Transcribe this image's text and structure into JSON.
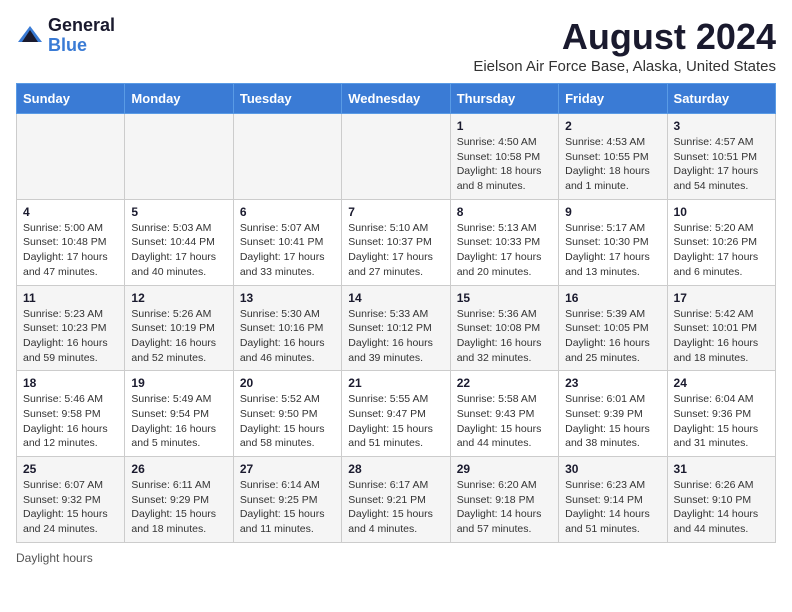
{
  "logo": {
    "general": "General",
    "blue": "Blue"
  },
  "title": "August 2024",
  "location": "Eielson Air Force Base, Alaska, United States",
  "days_of_week": [
    "Sunday",
    "Monday",
    "Tuesday",
    "Wednesday",
    "Thursday",
    "Friday",
    "Saturday"
  ],
  "weeks": [
    [
      {
        "day": "",
        "info": ""
      },
      {
        "day": "",
        "info": ""
      },
      {
        "day": "",
        "info": ""
      },
      {
        "day": "",
        "info": ""
      },
      {
        "day": "1",
        "info": "Sunrise: 4:50 AM\nSunset: 10:58 PM\nDaylight: 18 hours\nand 8 minutes."
      },
      {
        "day": "2",
        "info": "Sunrise: 4:53 AM\nSunset: 10:55 PM\nDaylight: 18 hours\nand 1 minute."
      },
      {
        "day": "3",
        "info": "Sunrise: 4:57 AM\nSunset: 10:51 PM\nDaylight: 17 hours\nand 54 minutes."
      }
    ],
    [
      {
        "day": "4",
        "info": "Sunrise: 5:00 AM\nSunset: 10:48 PM\nDaylight: 17 hours\nand 47 minutes."
      },
      {
        "day": "5",
        "info": "Sunrise: 5:03 AM\nSunset: 10:44 PM\nDaylight: 17 hours\nand 40 minutes."
      },
      {
        "day": "6",
        "info": "Sunrise: 5:07 AM\nSunset: 10:41 PM\nDaylight: 17 hours\nand 33 minutes."
      },
      {
        "day": "7",
        "info": "Sunrise: 5:10 AM\nSunset: 10:37 PM\nDaylight: 17 hours\nand 27 minutes."
      },
      {
        "day": "8",
        "info": "Sunrise: 5:13 AM\nSunset: 10:33 PM\nDaylight: 17 hours\nand 20 minutes."
      },
      {
        "day": "9",
        "info": "Sunrise: 5:17 AM\nSunset: 10:30 PM\nDaylight: 17 hours\nand 13 minutes."
      },
      {
        "day": "10",
        "info": "Sunrise: 5:20 AM\nSunset: 10:26 PM\nDaylight: 17 hours\nand 6 minutes."
      }
    ],
    [
      {
        "day": "11",
        "info": "Sunrise: 5:23 AM\nSunset: 10:23 PM\nDaylight: 16 hours\nand 59 minutes."
      },
      {
        "day": "12",
        "info": "Sunrise: 5:26 AM\nSunset: 10:19 PM\nDaylight: 16 hours\nand 52 minutes."
      },
      {
        "day": "13",
        "info": "Sunrise: 5:30 AM\nSunset: 10:16 PM\nDaylight: 16 hours\nand 46 minutes."
      },
      {
        "day": "14",
        "info": "Sunrise: 5:33 AM\nSunset: 10:12 PM\nDaylight: 16 hours\nand 39 minutes."
      },
      {
        "day": "15",
        "info": "Sunrise: 5:36 AM\nSunset: 10:08 PM\nDaylight: 16 hours\nand 32 minutes."
      },
      {
        "day": "16",
        "info": "Sunrise: 5:39 AM\nSunset: 10:05 PM\nDaylight: 16 hours\nand 25 minutes."
      },
      {
        "day": "17",
        "info": "Sunrise: 5:42 AM\nSunset: 10:01 PM\nDaylight: 16 hours\nand 18 minutes."
      }
    ],
    [
      {
        "day": "18",
        "info": "Sunrise: 5:46 AM\nSunset: 9:58 PM\nDaylight: 16 hours\nand 12 minutes."
      },
      {
        "day": "19",
        "info": "Sunrise: 5:49 AM\nSunset: 9:54 PM\nDaylight: 16 hours\nand 5 minutes."
      },
      {
        "day": "20",
        "info": "Sunrise: 5:52 AM\nSunset: 9:50 PM\nDaylight: 15 hours\nand 58 minutes."
      },
      {
        "day": "21",
        "info": "Sunrise: 5:55 AM\nSunset: 9:47 PM\nDaylight: 15 hours\nand 51 minutes."
      },
      {
        "day": "22",
        "info": "Sunrise: 5:58 AM\nSunset: 9:43 PM\nDaylight: 15 hours\nand 44 minutes."
      },
      {
        "day": "23",
        "info": "Sunrise: 6:01 AM\nSunset: 9:39 PM\nDaylight: 15 hours\nand 38 minutes."
      },
      {
        "day": "24",
        "info": "Sunrise: 6:04 AM\nSunset: 9:36 PM\nDaylight: 15 hours\nand 31 minutes."
      }
    ],
    [
      {
        "day": "25",
        "info": "Sunrise: 6:07 AM\nSunset: 9:32 PM\nDaylight: 15 hours\nand 24 minutes."
      },
      {
        "day": "26",
        "info": "Sunrise: 6:11 AM\nSunset: 9:29 PM\nDaylight: 15 hours\nand 18 minutes."
      },
      {
        "day": "27",
        "info": "Sunrise: 6:14 AM\nSunset: 9:25 PM\nDaylight: 15 hours\nand 11 minutes."
      },
      {
        "day": "28",
        "info": "Sunrise: 6:17 AM\nSunset: 9:21 PM\nDaylight: 15 hours\nand 4 minutes."
      },
      {
        "day": "29",
        "info": "Sunrise: 6:20 AM\nSunset: 9:18 PM\nDaylight: 14 hours\nand 57 minutes."
      },
      {
        "day": "30",
        "info": "Sunrise: 6:23 AM\nSunset: 9:14 PM\nDaylight: 14 hours\nand 51 minutes."
      },
      {
        "day": "31",
        "info": "Sunrise: 6:26 AM\nSunset: 9:10 PM\nDaylight: 14 hours\nand 44 minutes."
      }
    ]
  ],
  "footer": {
    "label": "Daylight hours"
  }
}
